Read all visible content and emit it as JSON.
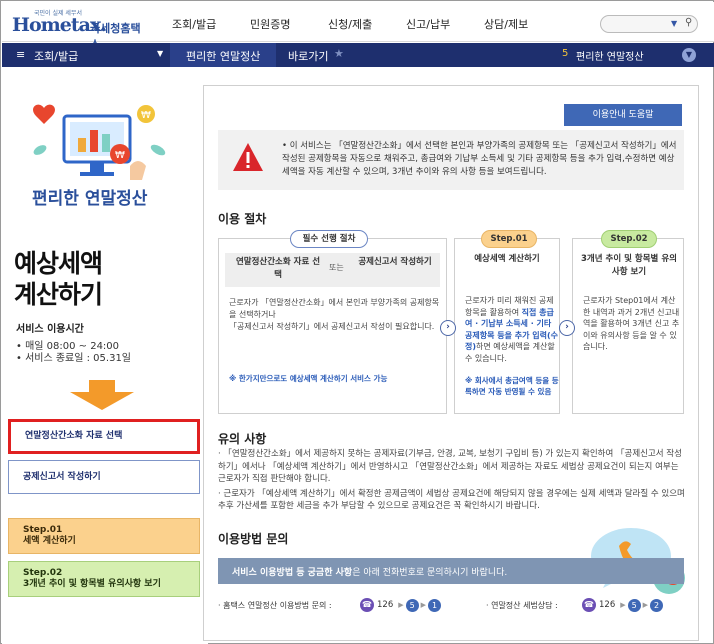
{
  "header": {
    "logo_small": "국민이 실제 세무서",
    "logo_main_a": "Home",
    "logo_main_b": "tax.",
    "logo_kr": "국세청홈택스",
    "nav": [
      "조회/발급",
      "민원증명",
      "신청/제출",
      "신고/납부",
      "상담/제보"
    ]
  },
  "navbar": {
    "category": "조회/발급",
    "crumb_current": "편리한 연말정산",
    "crumb_shortcut": "바로가기",
    "right_number": "5",
    "right_label": "편리한 연말정산"
  },
  "sidebar": {
    "sub_title": "편리한 연말정산",
    "big_title_line1": "예상세액",
    "big_title_line2": "계산하기",
    "service_hours_title": "서비스 이용시간",
    "service_hours_1": "• 매일 08:00 ~ 24:00",
    "service_hours_2": "• 서비스 종료일 : 05.31일",
    "buttons": {
      "select_data": "연말정산간소화 자료 선택",
      "write_report": "공제신고서 작성하기",
      "step01_a": "Step.01",
      "step01_b": "세액 계산하기",
      "step02_a": "Step.02",
      "step02_b": "3개년 추이 및 항목별 유의사항 보기"
    }
  },
  "main": {
    "help_button": "이용안내 도움말",
    "notice": "• 이 서비스는 「연말정산간소화」에서 선택한 본인과 부양가족의 공제항목 또는 「공제신고서 작성하기」에서 작성된 공제항목을 자동으로 채워주고, 총급여와 기납부 소득세 및 기타 공제항목 등을 추가 입력,수정하면 예상세액을 자동 계산할 수 있으며, 3개년 추이와 유의 사항 등을 보여드립니다.",
    "procedure_title": "이용 절차",
    "required_pill": "필수 선행 절차",
    "box1": {
      "col1": "연말정산간소화 자료 선택",
      "or": "또는",
      "col2": "공제신고서 작성하기",
      "body1": "근로자가 「연말정산간소화」에서 본인과 부양가족의 공제항목을 선택하거나",
      "body2": "「공제신고서 작성하기」에서 공제신고서 작성이 필요합니다.",
      "note": "※ 한가지만으로도 예상세액 계산하기 서비스 가능"
    },
    "step01_pill": "Step.01",
    "box2": {
      "title": "예상세액 계산하기",
      "body_a": "근로자가 미리 채워진 공제항목을 활용하여 ",
      "body_hl": "직접 총급여 · 기납부 소득세 · 기타 공제항목 등을 추가 입력(수정)",
      "body_b": "하면 예상세액을 계산할 수 있습니다.",
      "note": "※ 회사에서 총급여액 등을 등록하면 자동 반영될 수 있음"
    },
    "step02_pill": "Step.02",
    "box3": {
      "title": "3개년 추이 및 항목별 유의사항 보기",
      "body": "근로자가 Step01에서 계산한 내역과 과거 2개년 신고내역을 활용하여 3개년 신고 추이와 유의사항 등을 알 수 있습니다."
    },
    "notes_title": "유의 사항",
    "notes": [
      "· 「연말정산간소화」에서 제공하지 못하는 공제자료(기부금, 안경, 교복, 보청기 구입비 등) 가 있는지 확인하여 「공제신고서 작성하기」에서나 「예상세액 계산하기」에서 반영하시고 「연말정산간소화」에서 제공하는 자료도 세법상 공제요건이 되는지 여부는 근로자가 직접 판단해야 합니다.",
      "· 근로자가 「예상세액 계산하기」에서 확정한 공제금액이 세법상 공제요건에 해당되지 않을 경우에는 실제 세액과 달라질 수 있으며 추후 가산세를 포함한 세금을 추가 부담할 수 있으므로 공제요건은 꼭 확인하시기 바랍니다."
    ],
    "ask_title": "이용방법 문의",
    "banner_bold": "서비스 이용방법 등 궁금한 사항",
    "banner_rest": "은 아래 전화번호로 문의하시기 바랍니다.",
    "contact1_label": "· 홈택스 연말정산 이용방법 문의 :",
    "contact1_digits": [
      "126",
      "5",
      "1"
    ],
    "contact2_label": "· 연말정산 세법상담 :",
    "contact2_digits": [
      "126",
      "5",
      "2"
    ]
  },
  "colors": {
    "navbar": "#1e2f6e",
    "brand_blue": "#2a4f9b",
    "highlight_red": "#e02020",
    "step01": "#fbd18d",
    "step02": "#d6efb0"
  }
}
